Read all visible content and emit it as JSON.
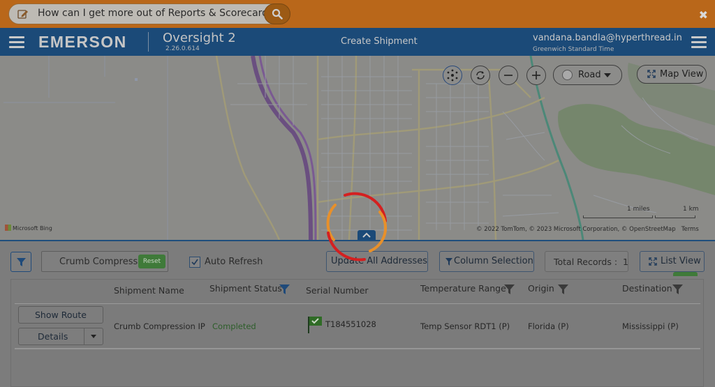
{
  "banner": {
    "question": "How can I get more out of Reports & Scorecards?",
    "close_label": "✖"
  },
  "header": {
    "logo": "EMERSON",
    "app_title": "Oversight 2",
    "app_version": "2.26.0.614",
    "page_title": "Create Shipment",
    "user_email": "vandana.bandla@hyperthread.in",
    "timezone": "Greenwich Standard Time"
  },
  "map": {
    "road_label": "Road",
    "map_view_label": "Map View",
    "scale_miles": "1 miles",
    "scale_km": "1 km",
    "provider": "Microsoft Bing",
    "copyright": "© 2022 TomTom, © 2023 Microsoft Corporation, © OpenStreetMap",
    "terms": "Terms"
  },
  "toolbar": {
    "search_value": "Crumb Compression",
    "reset_label": "Reset",
    "auto_refresh_label": "Auto Refresh",
    "auto_refresh_checked": true,
    "update_addresses_label": "Update All Addresses",
    "column_selection_label": "Column Selection",
    "total_records_label": "Total Records :",
    "total_records_value": "1",
    "list_view_label": "List View"
  },
  "table": {
    "headers": {
      "shipment_name": "Shipment Name",
      "shipment_status": "Shipment Status",
      "serial_number": "Serial Number",
      "temperature_range": "Temperature Range",
      "origin": "Origin",
      "destination": "Destination"
    },
    "rows": [
      {
        "show_route_label": "Show Route",
        "details_label": "Details",
        "shipment_name": "Crumb Compression IP",
        "shipment_status": "Completed",
        "serial_number": "T184551028",
        "temperature_range": "Temp Sensor RDT1 (P)",
        "origin": "Florida (P)",
        "destination": "Mississippi (P)"
      }
    ]
  },
  "colors": {
    "banner": "#b9671a",
    "header": "#1b4a78",
    "spinner_red": "#d42020",
    "spinner_orange": "#e8902a",
    "status_green": "#2d5e2a"
  }
}
